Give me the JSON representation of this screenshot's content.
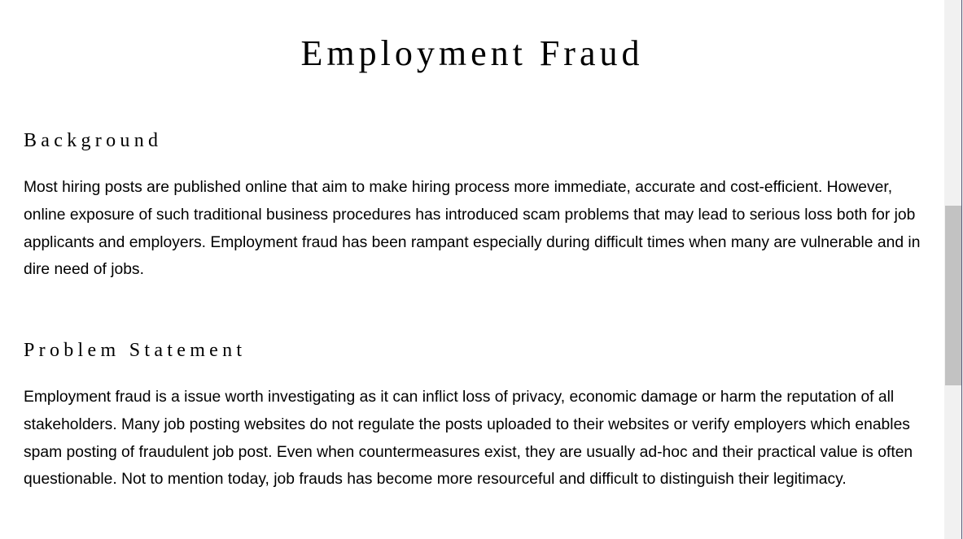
{
  "document": {
    "title": "Employment Fraud",
    "sections": [
      {
        "heading": "Background",
        "paragraph": "Most hiring posts are published online that aim to make hiring process more immediate, accurate and cost-efficient. However, online exposure of such traditional business procedures has introduced scam problems that may lead to serious loss both for job applicants and employers. Employment fraud has been rampant especially during difficult times when many are vulnerable and in dire need of jobs."
      },
      {
        "heading": "Problem Statement",
        "paragraph": "Employment fraud is a issue worth investigating as it can inflict loss of privacy, economic damage or harm the reputation of all stakeholders. Many job posting websites do not regulate the posts uploaded to their websites or verify employers which enables spam posting of fraudulent job post. Even when countermeasures exist, they are usually ad-hoc and their practical value is often questionable. Not to mention today, job frauds has become more resourceful and difficult to distinguish their legitimacy."
      }
    ]
  },
  "scrollbar": {
    "position_fraction": 0.38
  }
}
